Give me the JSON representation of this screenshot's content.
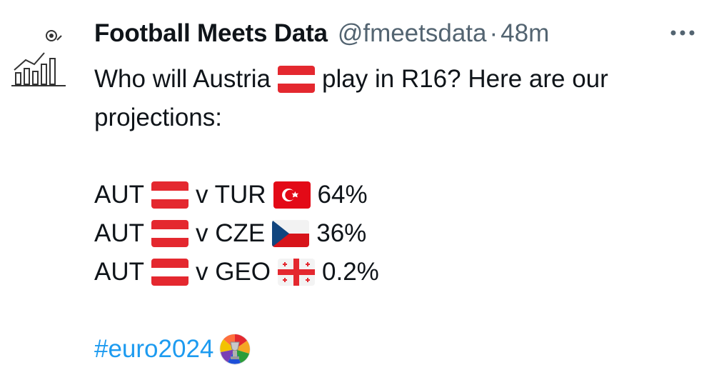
{
  "author": {
    "name": "Football Meets Data",
    "handle": "@fmeetsdata",
    "separator": "·",
    "time": "48m"
  },
  "avatar_icon": "bar-chart-football-icon",
  "more_icon": "more-horizontal-icon",
  "tweet": {
    "intro_part1": "Who will Austria",
    "intro_part2": "play in R16? Here are our",
    "intro_line2": "projections:",
    "matchups": [
      {
        "team": "AUT",
        "vs": "v TUR",
        "pct": "64%",
        "opponent_flag": "turkey-flag-icon"
      },
      {
        "team": "AUT",
        "vs": "v CZE",
        "pct": "36%",
        "opponent_flag": "czechia-flag-icon"
      },
      {
        "team": "AUT",
        "vs": "v GEO",
        "pct": "0.2%",
        "opponent_flag": "georgia-flag-icon"
      }
    ],
    "hashtag": "#euro2024"
  },
  "colors": {
    "text": "#0f1419",
    "muted": "#536471",
    "link": "#1d9bf0",
    "austria_red": "#e4282f",
    "turkey_red": "#e30a17"
  }
}
